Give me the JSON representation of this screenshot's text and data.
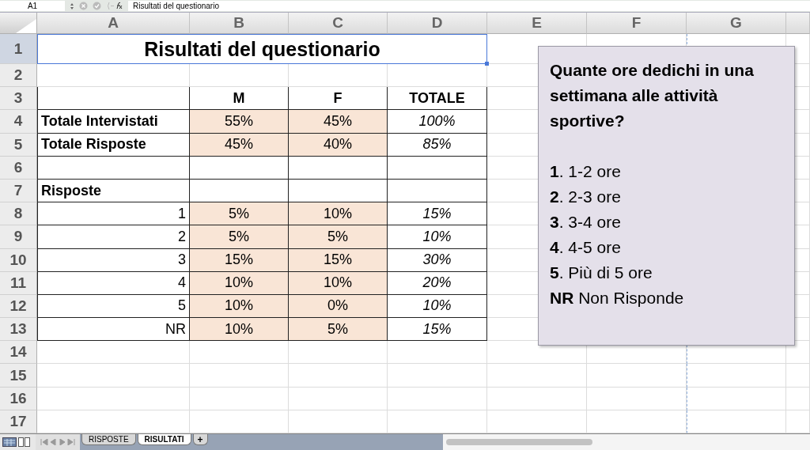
{
  "formula_bar": {
    "cell_ref": "A1",
    "formula": "Risultati del questionario"
  },
  "columns": [
    "A",
    "B",
    "C",
    "D",
    "E",
    "F",
    "G"
  ],
  "title_row": {
    "number": "1",
    "title": "Risultati del questionario"
  },
  "rows": [
    {
      "number": "2",
      "bordered": false,
      "cells": []
    },
    {
      "number": "3",
      "bordered": true,
      "cells": [
        {
          "kind": "empty"
        },
        {
          "kind": "header",
          "text": "M"
        },
        {
          "kind": "header",
          "text": "F"
        },
        {
          "kind": "header",
          "text": "TOTALE"
        }
      ]
    },
    {
      "number": "4",
      "bordered": true,
      "cells": [
        {
          "kind": "label",
          "text": "Totale Intervistati"
        },
        {
          "kind": "pct",
          "text": "55%"
        },
        {
          "kind": "pct",
          "text": "45%"
        },
        {
          "kind": "total",
          "text": "100%"
        }
      ]
    },
    {
      "number": "5",
      "bordered": true,
      "cells": [
        {
          "kind": "label",
          "text": "Totale Risposte"
        },
        {
          "kind": "pct",
          "text": "45%"
        },
        {
          "kind": "pct",
          "text": "40%"
        },
        {
          "kind": "total",
          "text": "85%"
        }
      ]
    },
    {
      "number": "6",
      "bordered": true,
      "cells": [
        {
          "kind": "empty"
        },
        {
          "kind": "empty"
        },
        {
          "kind": "empty"
        },
        {
          "kind": "empty"
        }
      ]
    },
    {
      "number": "7",
      "bordered": true,
      "cells": [
        {
          "kind": "label",
          "text": "Risposte"
        },
        {
          "kind": "empty"
        },
        {
          "kind": "empty"
        },
        {
          "kind": "empty"
        }
      ]
    },
    {
      "number": "8",
      "bordered": true,
      "cells": [
        {
          "kind": "number",
          "text": "1"
        },
        {
          "kind": "pct",
          "text": "5%"
        },
        {
          "kind": "pct",
          "text": "10%"
        },
        {
          "kind": "total",
          "text": "15%"
        }
      ]
    },
    {
      "number": "9",
      "bordered": true,
      "cells": [
        {
          "kind": "number",
          "text": "2"
        },
        {
          "kind": "pct",
          "text": "5%"
        },
        {
          "kind": "pct",
          "text": "5%"
        },
        {
          "kind": "total",
          "text": "10%"
        }
      ]
    },
    {
      "number": "10",
      "bordered": true,
      "cells": [
        {
          "kind": "number",
          "text": "3"
        },
        {
          "kind": "pct",
          "text": "15%"
        },
        {
          "kind": "pct",
          "text": "15%"
        },
        {
          "kind": "total",
          "text": "30%"
        }
      ]
    },
    {
      "number": "11",
      "bordered": true,
      "cells": [
        {
          "kind": "number",
          "text": "4"
        },
        {
          "kind": "pct",
          "text": "10%"
        },
        {
          "kind": "pct",
          "text": "10%"
        },
        {
          "kind": "total",
          "text": "20%"
        }
      ]
    },
    {
      "number": "12",
      "bordered": true,
      "cells": [
        {
          "kind": "number",
          "text": "5"
        },
        {
          "kind": "pct",
          "text": "10%"
        },
        {
          "kind": "pct",
          "text": "0%"
        },
        {
          "kind": "total",
          "text": "10%"
        }
      ]
    },
    {
      "number": "13",
      "bordered": true,
      "cells": [
        {
          "kind": "number",
          "text": "NR"
        },
        {
          "kind": "pct",
          "text": "10%"
        },
        {
          "kind": "pct",
          "text": "5%"
        },
        {
          "kind": "total",
          "text": "15%"
        }
      ]
    },
    {
      "number": "14",
      "bordered": false,
      "cells": []
    },
    {
      "number": "15",
      "bordered": false,
      "cells": []
    },
    {
      "number": "16",
      "bordered": false,
      "cells": []
    },
    {
      "number": "17",
      "bordered": false,
      "cells": []
    }
  ],
  "text_box": {
    "question": "Quante ore dedichi in una settimana alle attività sportive?",
    "options": [
      "**1**. 1-2 ore",
      "**2**. 2-3 ore",
      "**3**. 3-4 ore",
      "**4**. 4-5 ore",
      "**5**. Più di 5 ore",
      "**NR** Non Risponde"
    ]
  },
  "sheet_tabs": [
    {
      "label": "RISPOSTE",
      "selected": false
    },
    {
      "label": "RISULTATI",
      "selected": true
    }
  ],
  "add_sheet": "+"
}
